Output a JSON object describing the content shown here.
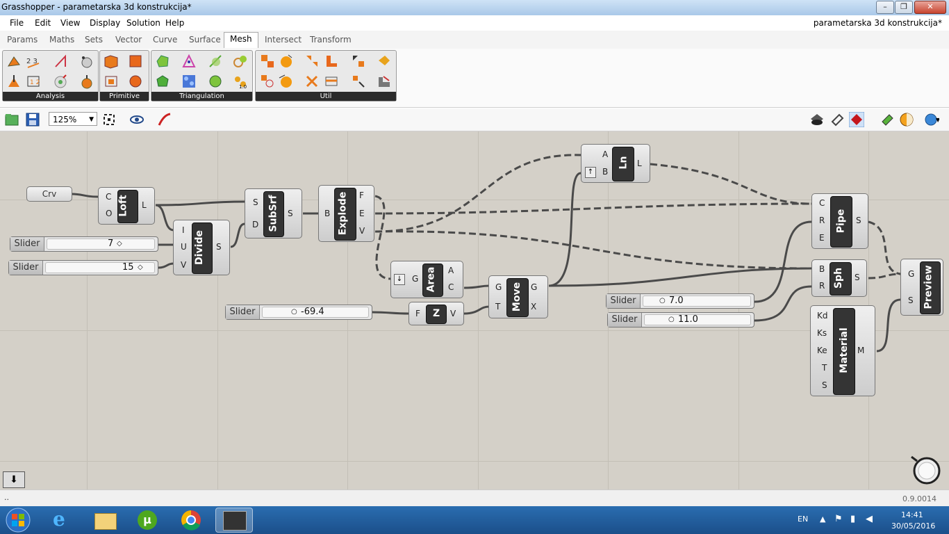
{
  "window": {
    "title": "Grasshopper - parametarska 3d konstrukcija*",
    "document_title": "parametarska 3d konstrukcija*"
  },
  "menu": [
    "File",
    "Edit",
    "View",
    "Display",
    "Solution",
    "Help"
  ],
  "tabs": [
    "Params",
    "Maths",
    "Sets",
    "Vector",
    "Curve",
    "Surface",
    "Mesh",
    "Intersect",
    "Transform"
  ],
  "active_tab": "Mesh",
  "ribbon_panels": [
    "Analysis",
    "Primitive",
    "Triangulation",
    "Util"
  ],
  "toolbar": {
    "zoom": "125%"
  },
  "canvas": {
    "params": {
      "crv": "Crv"
    },
    "sliders": [
      {
        "label": "Slider",
        "value": "7"
      },
      {
        "label": "Slider",
        "value": "15"
      },
      {
        "label": "Slider",
        "value": "-69.4"
      },
      {
        "label": "Slider",
        "value": "7.0"
      },
      {
        "label": "Slider",
        "value": "11.0"
      }
    ],
    "components": {
      "loft": {
        "name": "Loft",
        "inputs": [
          "C",
          "O"
        ],
        "outputs": [
          "L"
        ]
      },
      "divide": {
        "name": "Divide",
        "inputs": [
          "I",
          "U",
          "V"
        ],
        "outputs": [
          "S"
        ]
      },
      "subsrf": {
        "name": "SubSrf",
        "inputs": [
          "S",
          "D"
        ],
        "outputs": [
          "S"
        ]
      },
      "explode": {
        "name": "Explode",
        "inputs": [
          "B"
        ],
        "outputs": [
          "F",
          "E",
          "V"
        ]
      },
      "area": {
        "name": "Area",
        "inputs": [
          "G"
        ],
        "outputs": [
          "A",
          "C"
        ]
      },
      "z": {
        "name": "Z",
        "inputs": [
          "F"
        ],
        "outputs": [
          "V"
        ]
      },
      "move": {
        "name": "Move",
        "inputs": [
          "G",
          "T"
        ],
        "outputs": [
          "G",
          "X"
        ]
      },
      "ln": {
        "name": "Ln",
        "inputs": [
          "A",
          "B"
        ],
        "outputs": [
          "L"
        ]
      },
      "pipe": {
        "name": "Pipe",
        "inputs": [
          "C",
          "R",
          "E"
        ],
        "outputs": [
          "S"
        ]
      },
      "sph": {
        "name": "Sph",
        "inputs": [
          "B",
          "R"
        ],
        "outputs": [
          "S"
        ]
      },
      "material": {
        "name": "Material",
        "inputs": [
          "Kd",
          "Ks",
          "Ke",
          "T",
          "S"
        ],
        "outputs": [
          "M"
        ]
      },
      "preview": {
        "name": "Preview",
        "inputs": [
          "G",
          "S"
        ],
        "outputs": []
      }
    }
  },
  "status": {
    "left": "..",
    "version": "0.9.0014"
  },
  "taskbar": {
    "lang": "EN",
    "time": "14:41",
    "date": "30/05/2016"
  }
}
